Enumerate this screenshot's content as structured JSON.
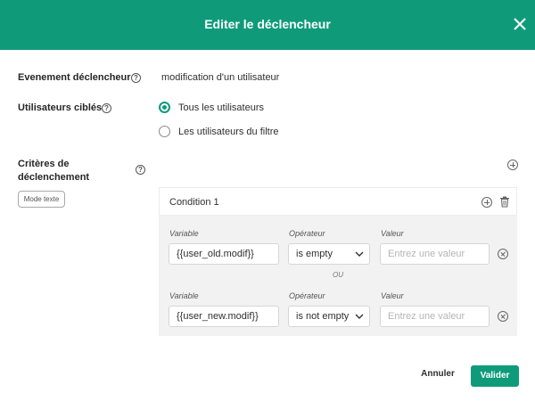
{
  "dialog": {
    "title": "Editer le déclencheur",
    "header_color": "#0f9b7a",
    "close_icon": "close-icon"
  },
  "fields": {
    "event_label": "Evenement déclencheur",
    "event_value": "modification d'un utilisateur",
    "targets_label": "Utilisateurs ciblés",
    "criteria_label_line1": "Critères de",
    "criteria_label_line2": "déclenchement",
    "help_icon": "?",
    "mode_text_button": "Mode texte"
  },
  "radio_options": [
    {
      "label": "Tous les utilisateurs",
      "selected": true
    },
    {
      "label": "Les utilisateurs du filtre",
      "selected": false
    }
  ],
  "condition": {
    "title": "Condition 1",
    "rows": [
      {
        "variable_label": "Variable",
        "variable_value": "{{user_old.modif}}",
        "operator_label": "Opérateur",
        "operator_value": "is empty",
        "value_label": "Valeur",
        "value_placeholder": "Entrez une valeur"
      },
      {
        "variable_label": "Variable",
        "variable_value": "{{user_new.modif}}",
        "operator_label": "Opérateur",
        "operator_value": "is not empty",
        "value_label": "Valeur",
        "value_placeholder": "Entrez une valeur"
      }
    ],
    "separator": "OU"
  },
  "footer": {
    "cancel_label": "Annuler",
    "submit_label": "Valider"
  }
}
